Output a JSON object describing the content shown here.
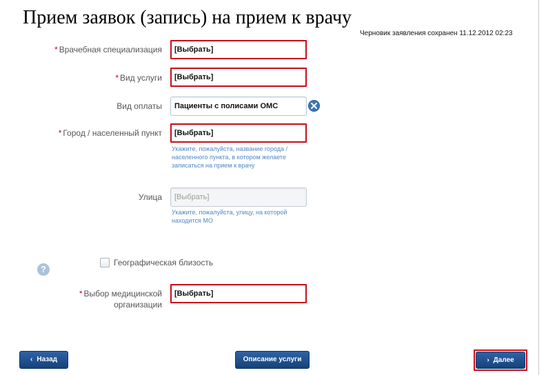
{
  "header": {
    "title": "Прием заявок (запись) на прием к врачу",
    "draft_status": "Черновик заявления сохранен 11.12.2012 02:23"
  },
  "form": {
    "required_mark": "*",
    "specialization": {
      "label": "Врачебная специализация",
      "value": "[Выбрать]"
    },
    "service_type": {
      "label": "Вид услуги",
      "value": "[Выбрать]"
    },
    "payment_type": {
      "label": "Вид оплаты",
      "value": "Пациенты с полисами ОМС"
    },
    "city": {
      "label": "Город / населенный пункт",
      "value": "[Выбрать]",
      "hint": "Укажите, пожалуйста, название города / населенного пункта, в котором желаете записаться на прием к врачу"
    },
    "street": {
      "label": "Улица",
      "value": "[Выбрать]",
      "hint": "Укажите, пожалуйста, улицу, на которой находится МО"
    },
    "geo_proximity": {
      "label": "Географическая близость",
      "checked": false
    },
    "organization": {
      "label_line1": "Выбор медицинской",
      "label_line2": "организации",
      "value": "[Выбрать]"
    },
    "help_glyph": "?"
  },
  "buttons": {
    "back": "Назад",
    "description": "Описание услуги",
    "next": "Далее",
    "chevron_left": "‹",
    "chevron_right": "›"
  },
  "colors": {
    "error_border": "#c80e1a",
    "button_blue": "#1f4f8f",
    "hint_text": "#4f88c4",
    "required": "#d0021b"
  }
}
